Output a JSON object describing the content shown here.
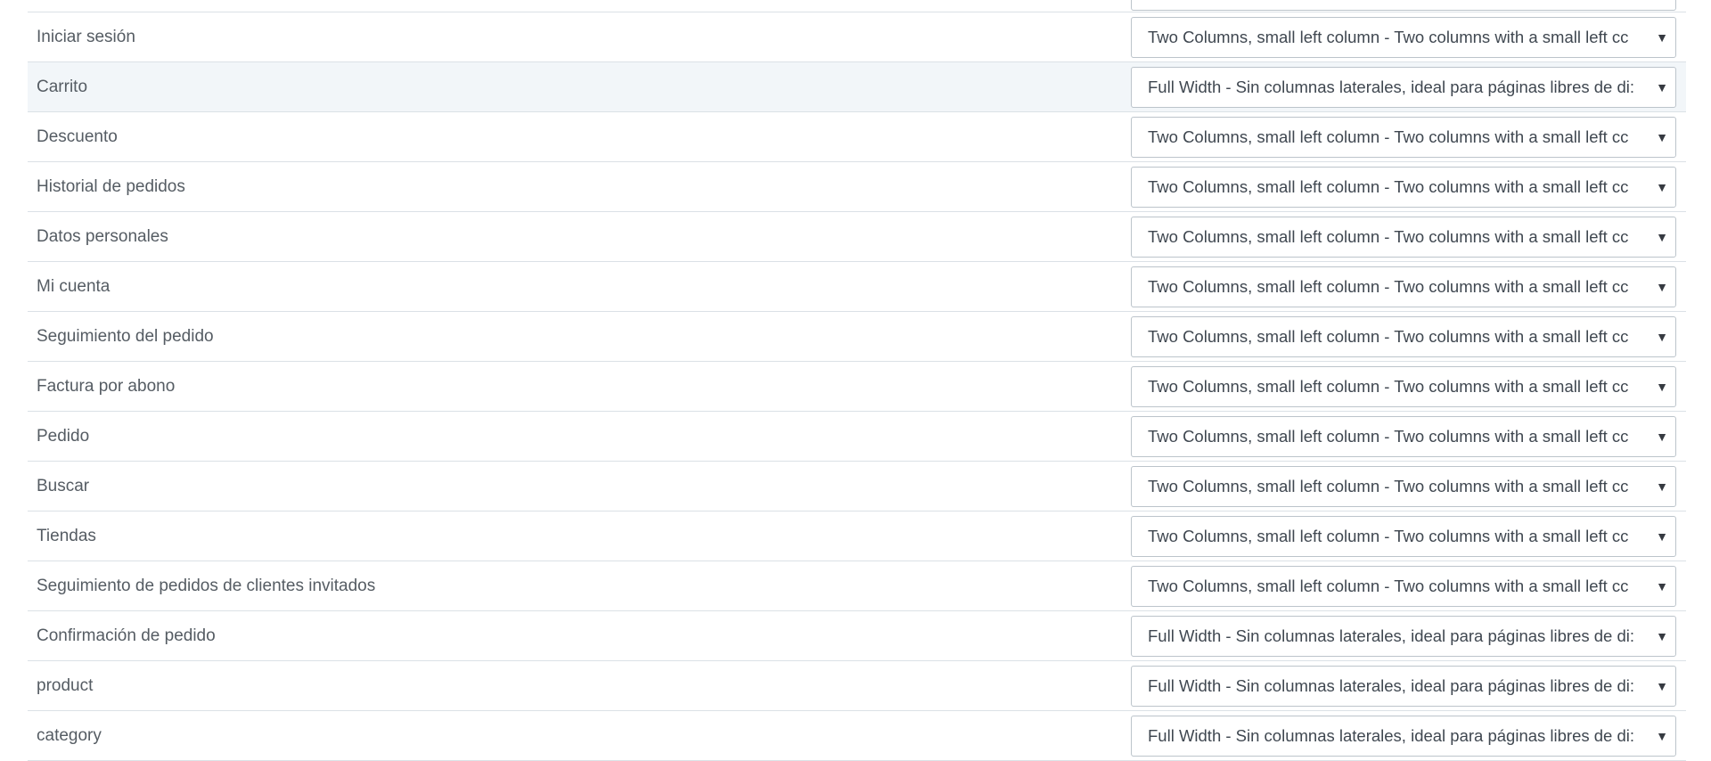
{
  "colors": {
    "border": "#dbe1e6",
    "highlight_row": "#f2f6f9",
    "label_text": "#555c63",
    "select_text": "#3f4750"
  },
  "caret_glyph": "▼",
  "rows": [
    {
      "label": "Iniciar sesión",
      "value": "Two Columns, small left column - Two columns with a small left cc"
    },
    {
      "label": "Carrito",
      "value": "Full Width - Sin columnas laterales, ideal para páginas libres de di:"
    },
    {
      "label": "Descuento",
      "value": "Two Columns, small left column - Two columns with a small left cc"
    },
    {
      "label": "Historial de pedidos",
      "value": "Two Columns, small left column - Two columns with a small left cc"
    },
    {
      "label": "Datos personales",
      "value": "Two Columns, small left column - Two columns with a small left cc"
    },
    {
      "label": "Mi cuenta",
      "value": "Two Columns, small left column - Two columns with a small left cc"
    },
    {
      "label": "Seguimiento del pedido",
      "value": "Two Columns, small left column - Two columns with a small left cc"
    },
    {
      "label": "Factura por abono",
      "value": "Two Columns, small left column - Two columns with a small left cc"
    },
    {
      "label": "Pedido",
      "value": "Two Columns, small left column - Two columns with a small left cc"
    },
    {
      "label": "Buscar",
      "value": "Two Columns, small left column - Two columns with a small left cc"
    },
    {
      "label": "Tiendas",
      "value": "Two Columns, small left column - Two columns with a small left cc"
    },
    {
      "label": "Seguimiento de pedidos de clientes invitados",
      "value": "Two Columns, small left column - Two columns with a small left cc"
    },
    {
      "label": "Confirmación de pedido",
      "value": "Full Width - Sin columnas laterales, ideal para páginas libres de di:"
    },
    {
      "label": "product",
      "value": "Full Width - Sin columnas laterales, ideal para páginas libres de di:"
    },
    {
      "label": "category",
      "value": "Full Width - Sin columnas laterales, ideal para páginas libres de di:"
    }
  ]
}
